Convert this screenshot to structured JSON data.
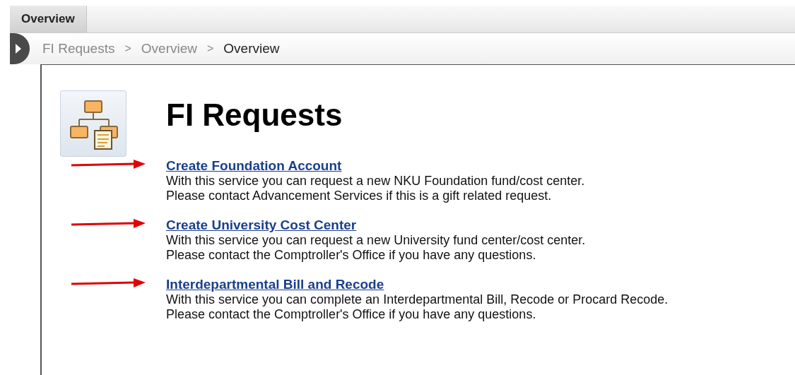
{
  "tabs": [
    {
      "label": "Overview",
      "selected": true
    }
  ],
  "breadcrumb": [
    "FI Requests",
    "Overview",
    "Overview"
  ],
  "breadcrumb_separators": [
    ">",
    ">"
  ],
  "title": "FI Requests",
  "services": [
    {
      "link": "Create Foundation Account",
      "lines": [
        "With this service you can request a new NKU Foundation fund/cost center.",
        "Please contact Advancement Services if this is a gift related request."
      ]
    },
    {
      "link": "Create University Cost Center",
      "lines": [
        "With this service you can request a new University fund center/cost center.",
        "Please contact the Comptroller's Office if you have any questions."
      ]
    },
    {
      "link": "Interdepartmental Bill and Recode",
      "lines": [
        "With this service you can complete an Interdepartmental Bill, Recode or Procard Recode.",
        "Please contact the Comptroller's Office if you have any questions."
      ]
    }
  ]
}
